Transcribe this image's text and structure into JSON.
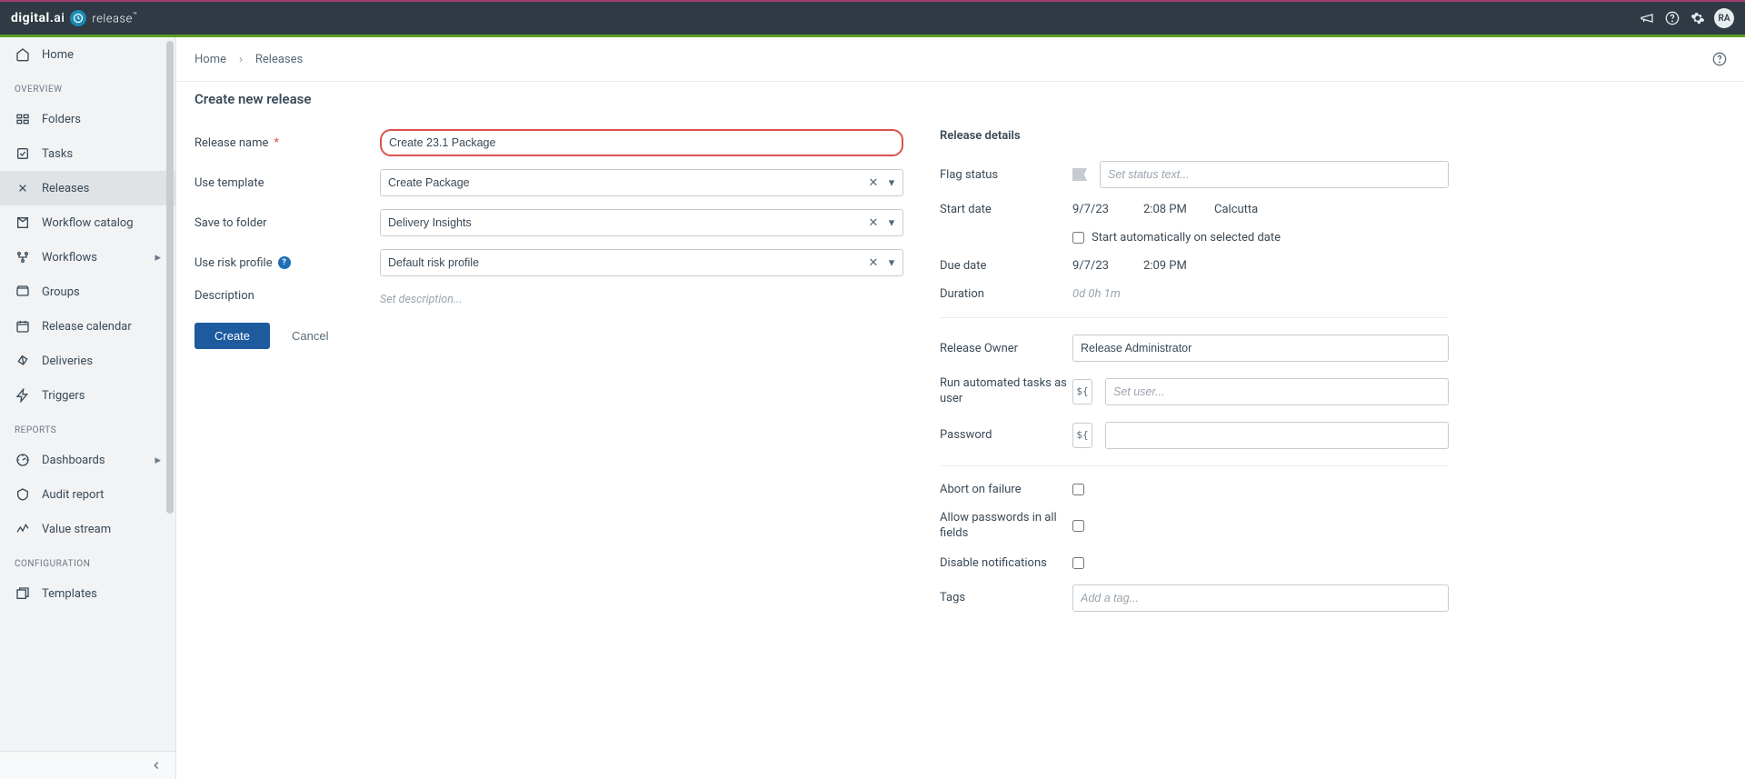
{
  "header": {
    "brand_prefix": "digital.",
    "brand_suffix": "ai",
    "product": "release",
    "tm": "™",
    "avatar": "RA"
  },
  "sidebar": {
    "home": "Home",
    "sections": {
      "overview": "OVERVIEW",
      "reports": "REPORTS",
      "configuration": "CONFIGURATION"
    },
    "items": {
      "folders": "Folders",
      "tasks": "Tasks",
      "releases": "Releases",
      "workflow_catalog": "Workflow catalog",
      "workflows": "Workflows",
      "groups": "Groups",
      "release_calendar": "Release calendar",
      "deliveries": "Deliveries",
      "triggers": "Triggers",
      "dashboards": "Dashboards",
      "audit_report": "Audit report",
      "value_stream": "Value stream",
      "templates": "Templates"
    }
  },
  "breadcrumbs": {
    "home": "Home",
    "releases": "Releases"
  },
  "page": {
    "title": "Create new release"
  },
  "form": {
    "labels": {
      "release_name": "Release name",
      "use_template": "Use template",
      "save_to_folder": "Save to folder",
      "use_risk_profile": "Use risk profile",
      "description": "Description"
    },
    "values": {
      "release_name": "Create 23.1 Package",
      "use_template": "Create Package",
      "save_to_folder": "Delivery Insights",
      "use_risk_profile": "Default risk profile"
    },
    "placeholders": {
      "description": "Set description..."
    },
    "buttons": {
      "create": "Create",
      "cancel": "Cancel"
    }
  },
  "details": {
    "title": "Release details",
    "labels": {
      "flag_status": "Flag status",
      "start_date": "Start date",
      "start_auto": "Start automatically on selected date",
      "due_date": "Due date",
      "duration": "Duration",
      "release_owner": "Release Owner",
      "run_as_user": "Run automated tasks as user",
      "password": "Password",
      "abort": "Abort on failure",
      "allow_pw": "Allow passwords in all fields",
      "disable_notif": "Disable notifications",
      "tags": "Tags"
    },
    "placeholders": {
      "flag": "Set status text...",
      "user": "Set user...",
      "tag": "Add a tag..."
    },
    "values": {
      "start_date": "9/7/23",
      "start_time": "2:08 PM",
      "start_tz": "Calcutta",
      "due_date": "9/7/23",
      "due_time": "2:09 PM",
      "duration": "0d 0h 1m",
      "owner": "Release Administrator",
      "var_token": "${"
    }
  }
}
